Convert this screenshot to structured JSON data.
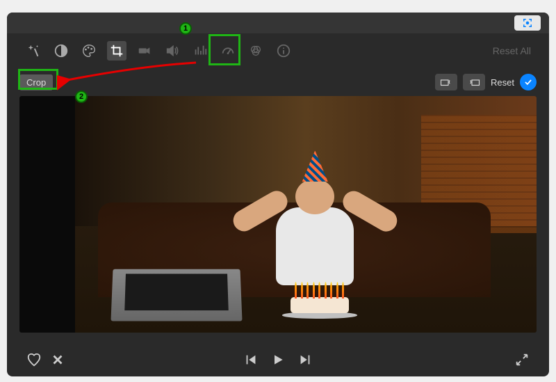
{
  "titlebar": {
    "capture_icon": "capture-icon"
  },
  "toolbar": {
    "wand_icon": "magic-wand-icon",
    "tools": [
      {
        "name": "color-balance-icon"
      },
      {
        "name": "color-palette-icon"
      },
      {
        "name": "crop-icon",
        "active": true
      },
      {
        "name": "video-camera-icon"
      },
      {
        "name": "audio-icon"
      },
      {
        "name": "equalizer-icon"
      },
      {
        "name": "speed-gauge-icon"
      },
      {
        "name": "color-wheel-icon"
      },
      {
        "name": "info-icon"
      }
    ],
    "reset_all_label": "Reset All"
  },
  "crop_controls": {
    "crop_label": "Crop",
    "rotate_ccw_icon": "rotate-ccw-icon",
    "rotate_cw_icon": "rotate-cw-icon",
    "reset_label": "Reset",
    "apply_icon": "checkmark-icon"
  },
  "bottom_controls": {
    "favorite_icon": "heart-icon",
    "reject_icon": "x-icon",
    "prev_icon": "skip-back-icon",
    "play_icon": "play-icon",
    "next_icon": "skip-forward-icon",
    "fullscreen_icon": "expand-icon"
  },
  "annotations": {
    "badge_1": "1",
    "badge_2": "2"
  }
}
